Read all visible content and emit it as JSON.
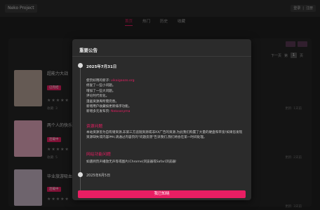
{
  "header": {
    "brand": "Neko Project",
    "auth": {
      "login": "登录",
      "sep": "|",
      "register": "注册"
    }
  },
  "nav": {
    "items": [
      "首页",
      "热门",
      "历史",
      "收藏"
    ],
    "active_index": 0
  },
  "background_list": {
    "pager": {
      "next": "下一页",
      "page_label": "第",
      "page": "1",
      "suffix": "页"
    },
    "items": [
      {
        "title": "超能力大战",
        "tag": "已完结",
        "stars": "★★★★★",
        "meta": "收藏: 3",
        "right_meta": "更新: 1天前",
        "cover": "#b9a59a"
      },
      {
        "title": "两个人的快乐",
        "tag": "连载中",
        "stars": "★★★★★",
        "meta": "收藏: 5",
        "right_meta": "更新: 2天前",
        "cover": "#e6a9bf"
      },
      {
        "title": "毕业旅游吸血鬼",
        "tag": "连载中",
        "stars": "★★★★★",
        "meta": "收藏: 2",
        "right_meta": "更新: 3天前",
        "cover": "#c9b7c7"
      }
    ]
  },
  "modal": {
    "title": "重要公告",
    "entry1": {
      "date": "2025年7月31日",
      "lines": [
        {
          "pre": "使页好用的新子: ",
          "link": "vikaigaozo.org",
          "post": ""
        },
        {
          "pre": "修复了一些小问题。",
          "link": "",
          "post": ""
        },
        {
          "pre": "增加了一些大问题。",
          "link": "",
          "post": ""
        },
        {
          "pre": "评论时代优化。",
          "link": "",
          "post": ""
        },
        {
          "pre": "漫画资源库所需完善。",
          "link": "",
          "post": ""
        },
        {
          "pre": "新增用户收藏按更新排序功能。",
          "link": "",
          "post": ""
        },
        {
          "pre": "新增多元发布页: ",
          "link": "Nekoanyma",
          "post": ""
        }
      ]
    },
    "section1": {
      "title": "资源问题",
      "text": "本站资源皆为自有储资源,非第三方追链资源或非XX广告的资源,为此我们购置了大量的硬盘和带宽!如果您发现资源缺失或内容冲H,请通过内容页的\"问题反馈\"告诉我们,我们将会在第一时间处理。"
    },
    "section2": {
      "title": "网站功能问题",
      "text": "如遇到页声播放无声等或图片(Chrome)浏览器或Safari浏览器!"
    },
    "entry2": {
      "date": "2025年6月5日"
    },
    "confirm_label": "我已知晓"
  },
  "colors": {
    "accent": "#e91e63",
    "modal_bg": "#2b2b2b",
    "page_bg": "#1f1f1f"
  }
}
